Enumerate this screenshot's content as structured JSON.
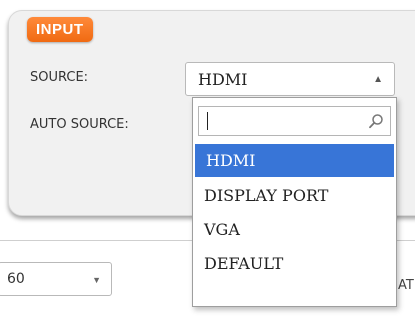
{
  "panel": {
    "tag": "INPUT",
    "accent_color": "#f27420",
    "source_label": "SOURCE:",
    "auto_source_label": "AUTO SOURCE:",
    "source_value": "HDMI",
    "source_arrow": "▲"
  },
  "dropdown": {
    "search_value": "",
    "search_icon": "magnifier-icon",
    "options": [
      "HDMI",
      "DISPLAY PORT",
      "VGA",
      "DEFAULT"
    ],
    "selected_index": 0,
    "selected_color": "#3875d7"
  },
  "lower": {
    "select_value": "60",
    "select_arrow": "▼",
    "cut_text": "AT"
  }
}
